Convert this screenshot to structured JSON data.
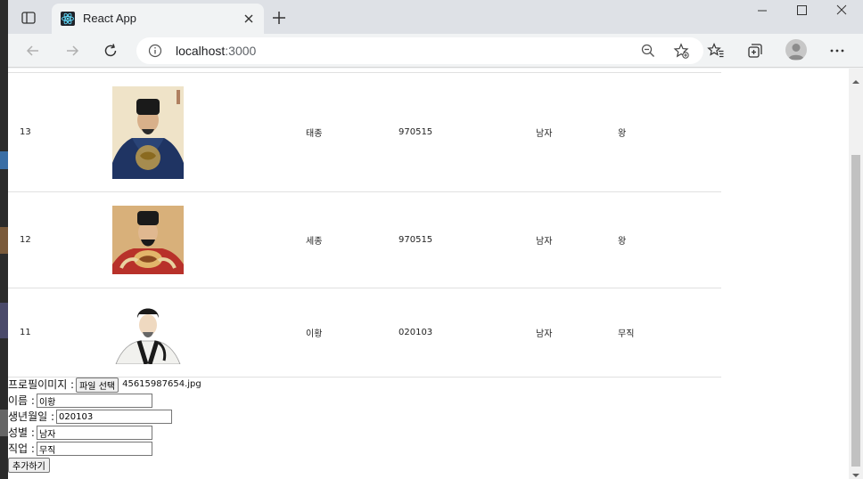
{
  "browser": {
    "tab_title": "React App",
    "url_host": "localhost",
    "url_port": ":3000"
  },
  "table": {
    "rows": [
      {
        "id": "13",
        "name": "태종",
        "birthday": "970515",
        "gender": "남자",
        "job": "왕",
        "portrait": "robed-king-blue"
      },
      {
        "id": "12",
        "name": "세종",
        "birthday": "970515",
        "gender": "남자",
        "job": "왕",
        "portrait": "robed-king-red"
      },
      {
        "id": "11",
        "name": "이황",
        "birthday": "020103",
        "gender": "남자",
        "job": "무직",
        "portrait": "scholar-white"
      }
    ]
  },
  "form": {
    "profile_label": "프로필이미지 : ",
    "file_button": "파일 선택",
    "file_name": "45615987654.jpg",
    "name_label": "이름 : ",
    "name_value": "이황",
    "birth_label": "생년월일 : ",
    "birth_value": "020103",
    "gender_label": "성별 : ",
    "gender_value": "남자",
    "job_label": "직업 : ",
    "job_value": "무직",
    "submit_label": "추가하기"
  },
  "colors": {
    "tabbar": "#dee1e6",
    "toolbar": "#f1f3f4",
    "page": "#ffffff"
  }
}
